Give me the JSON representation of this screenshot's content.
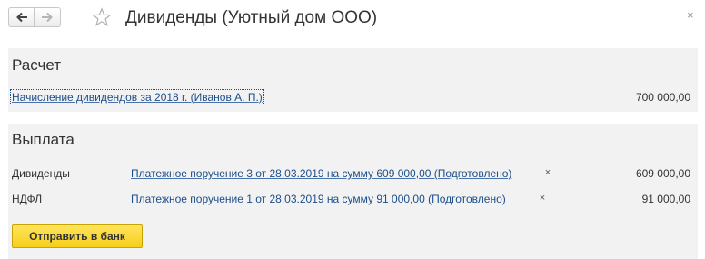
{
  "window": {
    "title": "Дивиденды (Уютный дом ООО)",
    "back_icon": "arrow-left-icon",
    "forward_icon": "arrow-right-icon",
    "favorite_icon": "star-icon",
    "close_icon": "close-icon",
    "close_glyph": "×"
  },
  "calculation": {
    "title": "Расчет",
    "rows": [
      {
        "link": "Начисление дивидендов за 2018 г. (Иванов А. П.)",
        "amount": "700 000,00"
      }
    ]
  },
  "payment": {
    "title": "Выплата",
    "rows": [
      {
        "label": "Дивиденды",
        "link": "Платежное поручение 3 от 28.03.2019 на сумму 609 000,00 (Подготовлено)",
        "remove": "×",
        "amount": "609 000,00"
      },
      {
        "label": "НДФЛ",
        "link": "Платежное поручение 1 от 28.03.2019 на сумму 91 000,00 (Подготовлено)",
        "remove": "×",
        "amount": "91 000,00"
      }
    ],
    "send_button": "Отправить в банк"
  },
  "colors": {
    "section_bg": "#f2f2f2",
    "link": "#1c4e8a",
    "button_yellow": "#f6cf1a"
  }
}
